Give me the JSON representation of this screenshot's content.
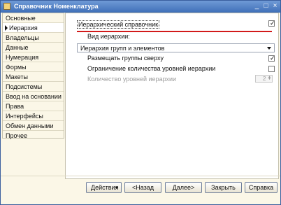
{
  "window": {
    "title": "Справочник Номенклатура",
    "controls": {
      "minimize": "_",
      "maximize": "□",
      "close": "×"
    }
  },
  "sidebar": {
    "items": [
      {
        "label": "Основные",
        "active": false
      },
      {
        "label": "Иерархия",
        "active": true
      },
      {
        "label": "Владельцы",
        "active": false
      },
      {
        "label": "Данные",
        "active": false
      },
      {
        "label": "Нумерация",
        "active": false
      },
      {
        "label": "Формы",
        "active": false
      },
      {
        "label": "Макеты",
        "active": false
      },
      {
        "label": "Подсистемы",
        "active": false
      },
      {
        "label": "Ввод на основании",
        "active": false
      },
      {
        "label": "Права",
        "active": false
      },
      {
        "label": "Интерфейсы",
        "active": false
      },
      {
        "label": "Обмен данными",
        "active": false
      },
      {
        "label": "Прочее",
        "active": false
      }
    ]
  },
  "panel": {
    "hierarchical_label": "Иерархический справочник",
    "hierarchical_checked": true,
    "hierarchy_type_label": "Вид иерархии:",
    "hierarchy_type_value": "Иерархия групп и элементов",
    "groups_on_top_label": "Размещать группы сверху",
    "groups_on_top_checked": true,
    "limit_levels_label": "Ограничение количества уровней иерархии",
    "limit_levels_checked": false,
    "levels_count_label": "Количество уровней иерархии",
    "levels_count_value": "2"
  },
  "buttons": {
    "actions": "Действия",
    "back": "<Назад",
    "next": "Далее>",
    "close": "Закрыть",
    "help": "Справка"
  },
  "colors": {
    "title_bar": "#3f6fb8",
    "underline_annotation": "#d21a1a",
    "background": "#fbf7e7"
  },
  "icons": {
    "window_icon": "catalog-icon",
    "active_nav_marker": "triangle-right-icon",
    "check_mark": "check-icon"
  }
}
